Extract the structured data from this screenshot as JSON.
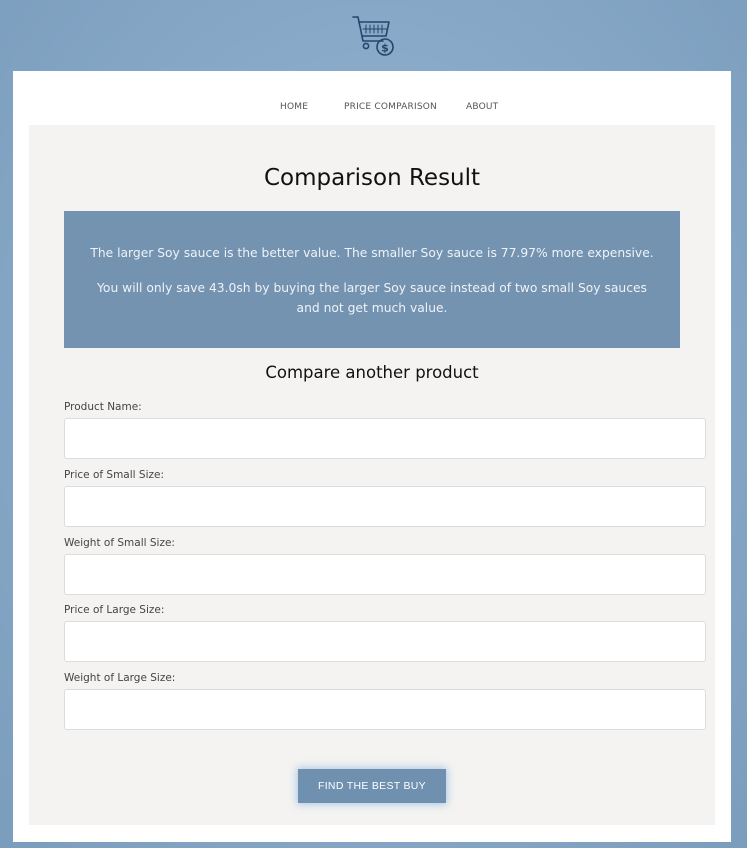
{
  "logo": {
    "icon": "shopping-cart-dollar-icon",
    "color": "#24466b"
  },
  "nav": {
    "home": "HOME",
    "price_comparison": "PRICE COMPARISON",
    "about": "ABOUT"
  },
  "result": {
    "title": "Comparison Result",
    "line1": "The larger Soy sauce is the better value. The smaller Soy sauce is 77.97% more expensive.",
    "line2": "You will only save 43.0sh by buying the larger Soy sauce instead of two small Soy sauces and not get much value."
  },
  "form": {
    "heading": "Compare another product",
    "fields": [
      {
        "label": "Product Name:",
        "value": ""
      },
      {
        "label": "Price of Small Size:",
        "value": ""
      },
      {
        "label": "Weight of Small Size:",
        "value": ""
      },
      {
        "label": "Price of Large Size:",
        "value": ""
      },
      {
        "label": "Weight of Large Size:",
        "value": ""
      }
    ],
    "submit_label": "FIND THE BEST BUY"
  },
  "colors": {
    "accent": "#7090b0",
    "result_box": "#7493b1",
    "background": "#8aabc9",
    "content_bg": "#f4f3f1"
  }
}
